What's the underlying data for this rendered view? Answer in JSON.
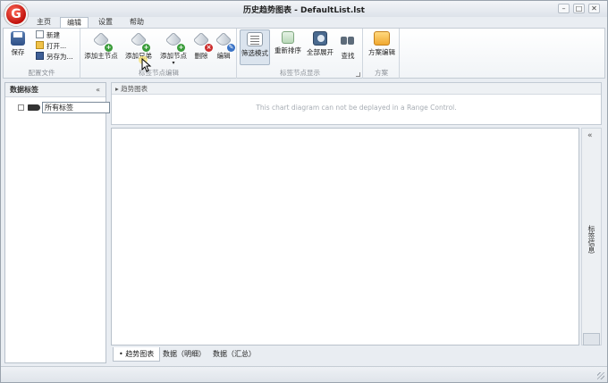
{
  "window": {
    "title": "历史趋势图表 - DefaultList.lst",
    "logo_letter": "G",
    "minimize": "–",
    "maximize": "□",
    "close": "✕"
  },
  "tabs": [
    {
      "label": "主页"
    },
    {
      "label": "编辑"
    },
    {
      "label": "设置"
    },
    {
      "label": "帮助"
    }
  ],
  "ribbon": {
    "group_config": {
      "label": "配置文件",
      "save": "保存",
      "new": "新建",
      "open": "打开...",
      "save_as": "另存为..."
    },
    "group_tag_edit": {
      "label": "标签节点编辑",
      "add_main_node": "添加主节点",
      "add_sibling": "添加兄弟",
      "add_node": "添加节点",
      "delete": "删除",
      "edit": "编辑"
    },
    "group_tag_display": {
      "label": "标签节点显示",
      "filter_mode": "筛选模式",
      "resort": "重新排序",
      "expand_all": "全部展开",
      "find": "查找"
    },
    "group_scheme": {
      "label": "方案",
      "scheme_edit": "方案编辑"
    }
  },
  "left_panel": {
    "title": "数据标签",
    "collapse": "«",
    "root_node": "所有标签"
  },
  "overview": {
    "title": "趋势图表",
    "message": "This chart diagram can not be deplayed in a Range Control."
  },
  "side_panel": {
    "collapse": "«",
    "label": "标签信息"
  },
  "bottom_tabs": [
    {
      "label": "趋势图表"
    },
    {
      "label": "数据（明细）"
    },
    {
      "label": "数据（汇总）"
    }
  ],
  "colors": {
    "accent": "#c0100a",
    "chrome": "#e9edf2"
  }
}
